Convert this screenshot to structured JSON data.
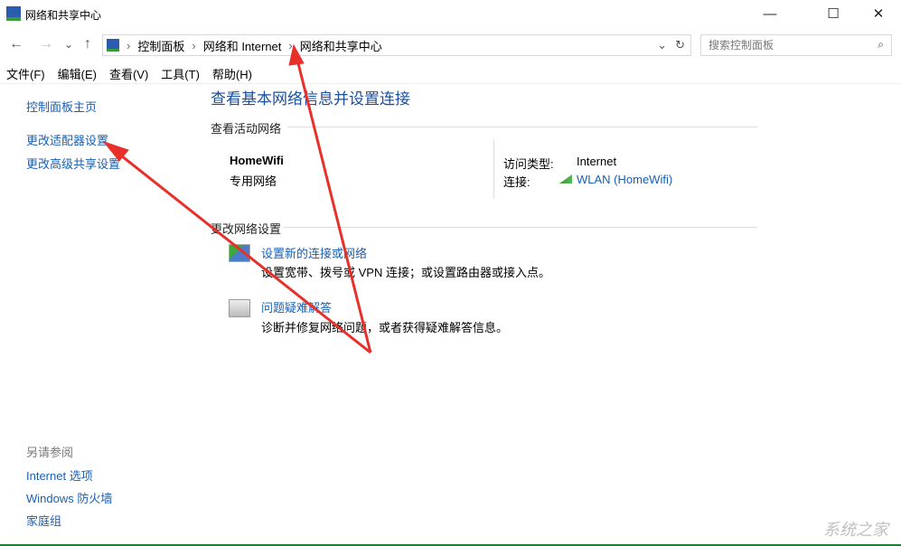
{
  "window": {
    "title": "网络和共享中心",
    "minimize": "—",
    "maximize": "☐",
    "close": "✕"
  },
  "nav": {
    "back": "←",
    "forward": "→",
    "recent": "⌄",
    "up": "↑",
    "breadcrumb": [
      "控制面板",
      "网络和 Internet",
      "网络和共享中心"
    ],
    "dropdown": "⌄",
    "refresh": "↻",
    "search_placeholder": "搜索控制面板",
    "search_icon": "⌕"
  },
  "menu": [
    "文件(F)",
    "编辑(E)",
    "查看(V)",
    "工具(T)",
    "帮助(H)"
  ],
  "sidebar": {
    "links": [
      "控制面板主页",
      "更改适配器设置",
      "更改高级共享设置"
    ],
    "see_also": "另请参阅",
    "see_also_links": [
      "Internet 选项",
      "Windows 防火墙",
      "家庭组"
    ]
  },
  "main": {
    "title": "查看基本网络信息并设置连接",
    "active_section": "查看活动网络",
    "network_name": "HomeWifi",
    "network_type": "专用网络",
    "access_label": "访问类型:",
    "access_value": "Internet",
    "conn_label": "连接:",
    "conn_value": "WLAN (HomeWifi)",
    "change_section": "更改网络设置",
    "tasks": [
      {
        "title": "设置新的连接或网络",
        "desc": "设置宽带、拨号或 VPN 连接；或设置路由器或接入点。"
      },
      {
        "title": "问题疑难解答",
        "desc": "诊断并修复网络问题，或者获得疑难解答信息。"
      }
    ]
  },
  "watermark": "系统之家",
  "colors": {
    "link": "#1a5fb4",
    "arrow": "#e8302a"
  }
}
